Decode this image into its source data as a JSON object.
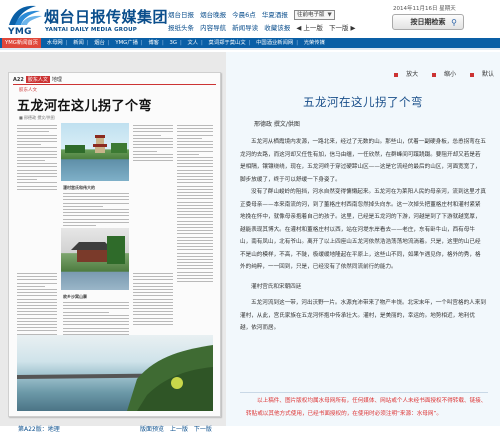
{
  "header": {
    "logo_text": "YMG",
    "group_name_cn": "烟台日报传媒集团",
    "group_name_en": "YANTAI DAILY MEDIA GROUP",
    "nav_row1": [
      "烟台日报",
      "烟台晚报",
      "今晨6点",
      "华夏酒报"
    ],
    "edition_select": "往前电子版",
    "nav_row2": [
      "报纸头条",
      "内容导航",
      "新闻导读",
      "收藏该报"
    ],
    "prev_page": "上一版",
    "next_page": "下一版",
    "date": "2014年11月16日 星期天",
    "search_button": "按日期检索"
  },
  "navbar": {
    "home": "YMG新闻首页",
    "items": [
      "水母网",
      "新闻",
      "烟台",
      "YMG广播",
      "博客",
      "3G",
      "文人",
      "莫词郑于莫山文",
      "中国酒业新闻网",
      "光荣传媒"
    ]
  },
  "page_view": {
    "page_number": "A22",
    "section_tag": "胶东人文",
    "section_name": "地理",
    "kicker": "胶东人文",
    "title": "五龙河在这儿拐了个弯",
    "byline": "■ 邢德政  撰文/供图",
    "subheads": [
      "灌村宫氏和伟大的",
      "故乡沙窝山寨"
    ],
    "footer_page": "第A22版：地理",
    "footer_nav": [
      "版面预览",
      "上一版",
      "下一版"
    ]
  },
  "article": {
    "font_controls": [
      "放大",
      "缩小",
      "默认"
    ],
    "title": "五龙河在这儿拐了个弯",
    "author": "邢德政   撰文/供图",
    "paragraphs": [
      "五龙河从栖霞境内发源，一路北来，经过了无数的山。那些山，伏着一副硬身板，怂恿拐弯在五龙河的去路，而这河却又任性有加，信马由缰，一任欣然，在群峰间可蹊跷蹑。要阻开却又若是若是相隔，镶镶绕绕，现在，五龙河终于穿过硬蹄山区——这是它流经的最后的山区，河面宽宽了，脚步放缓了，终于可以舒缓一下身姿了。",
      "没有了群山峻岭的阻挡，河水自然变得慵懒起来。五龙河在为莱阳人民的母亲河，流到这里才真正委母亲——本来南流的河，到了董格庄村西南忽然掉头向东。这一次掉头把董格庄村和灌村紧紧地挽在怀中，就像母亲抱着自己的孩子。这里，已经是五龙河的下游，河越是到了下游就越宽厚，越能表现其博大。在灌村和董格庄村以西，站在河堤东岸看去——老庄，东有卧牛山，西有母牛山，南有凤山，北有爷山。离开了以上四座山五龙河依然浩浩荡荡地流淌着。只是，这里的山已经不是山的模样，不高，不陡，极缓缓地隆起在平原上，这些山不同，如果乍遇见你，格外的秀，格外的纯粹，一一回到，只是，已经没有了依然同流前行的能力。"
    ],
    "subheading": "灌村宫氏和宋朝四廷",
    "paragraph3": "五龙河流到这一带，河出沃野一片。水源充沛带来了物产丰饶。北宋末年，一个叫宫格的人来到灌村，从此，宫氏家族在五龙河怀抱中传承壮大。灌村，是美丽的，幸运的。地势相近，地利优越，依河而居。",
    "note": "以上稿件、图片版权均属水母网所有，任何媒体、网站或个人未经书面授权不得转载、链接、转贴或以其他方式使用，已经书面授权的，在使用时必须注明“来源：水母网”。"
  }
}
